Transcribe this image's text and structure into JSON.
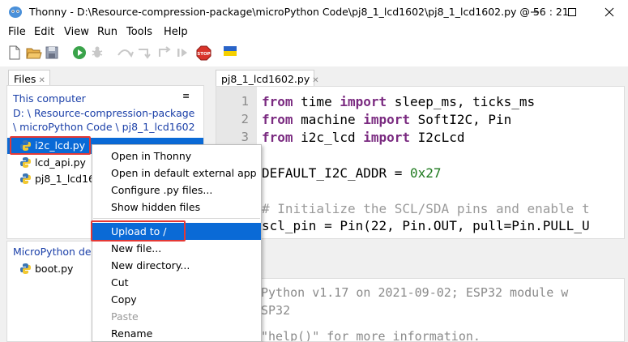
{
  "window": {
    "title": "Thonny  -  D:\\Resource-compression-package\\microPython Code\\pj8_1_lcd1602\\pj8_1_lcd1602.py  @  56 : 21"
  },
  "menu": [
    "File",
    "Edit",
    "View",
    "Run",
    "Tools",
    "Help"
  ],
  "files_panel": {
    "tab_label": "Files",
    "this_computer": "This computer",
    "path_line1": "D: \\ Resource-compression-package",
    "path_line2": "\\ microPython Code \\ pj8_1_lcd1602",
    "files": [
      "i2c_lcd.py",
      "lcd_api.py",
      "pj8_1_lcd16"
    ],
    "micropython_label": "MicroPython dev",
    "device_files": [
      "boot.py"
    ]
  },
  "editor": {
    "tab_label": "pj8_1_lcd1602.py",
    "line_numbers": [
      "1",
      "2",
      "3"
    ],
    "lines": [
      {
        "kw1": "from",
        "t1": " time ",
        "kw2": "import",
        "t2": " sleep_ms, ticks_ms"
      },
      {
        "kw1": "from",
        "t1": " machine ",
        "kw2": "import",
        "t2": " SoftI2C, Pin"
      },
      {
        "kw1": "from",
        "t1": " i2c_lcd ",
        "kw2": "import",
        "t2": " I2cLcd"
      }
    ],
    "addr_name": "DEFAULT_I2C_ADDR = ",
    "addr_value": "0x27",
    "comment": "# Initialize the SCL/SDA pins and enable t",
    "scl_line": "scl_pin = Pin(22, Pin.OUT, pull=Pin.PULL_U"
  },
  "shell": {
    "line1": "Python v1.17 on 2021-09-02; ESP32 module w",
    "line2": "SP32",
    "line3": "\"help()\" for more information."
  },
  "context_menu": {
    "items": [
      "Open in Thonny",
      "Open in default external app",
      "Configure .py files...",
      "Show hidden files"
    ],
    "selected": "Upload to /",
    "items2": [
      "New file...",
      "New directory...",
      "Cut",
      "Copy"
    ],
    "disabled": "Paste",
    "rename": "Rename"
  },
  "colors": {
    "selection": "#0a6ad6",
    "highlight_box": "#e53935",
    "keyword": "#7a2a80",
    "number": "#1f7a1f",
    "link": "#1a3fa8"
  }
}
